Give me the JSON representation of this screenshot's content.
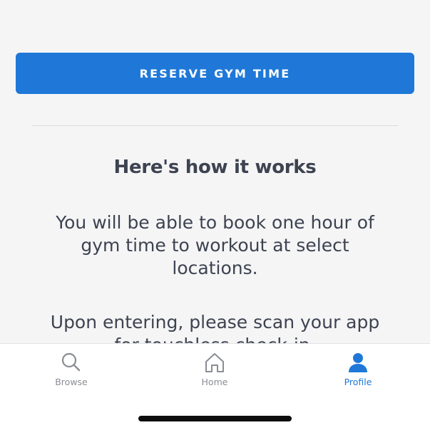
{
  "reserve_button": {
    "label": "RESERVE GYM TIME"
  },
  "info": {
    "heading": "Here's how it works",
    "paragraphs": [
      "You will be able to book one hour of gym time to workout at select locations.",
      "Upon entering, please scan your app for touchless check-in."
    ]
  },
  "tabbar": {
    "items": [
      {
        "label": "Browse",
        "icon": "search-icon",
        "active": false
      },
      {
        "label": "Home",
        "icon": "home-icon",
        "active": false
      },
      {
        "label": "Profile",
        "icon": "profile-icon",
        "active": true
      }
    ]
  },
  "colors": {
    "accent": "#1f78d7",
    "text": "#3d4350",
    "inactive_tab": "#8a8d94",
    "background": "#f5f5f6"
  }
}
